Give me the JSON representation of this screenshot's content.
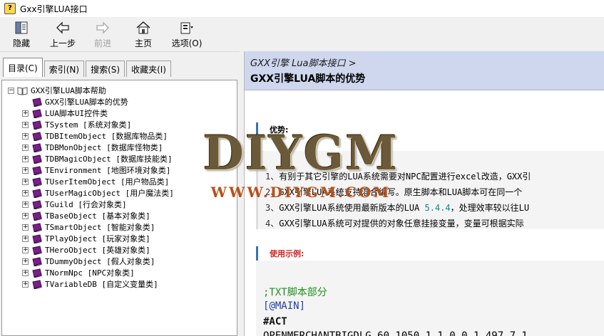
{
  "window": {
    "title": "Gxx引擎LUA接口"
  },
  "toolbar": {
    "hide": "隐藏",
    "back": "上一步",
    "forward": "前进",
    "home": "主页",
    "options": "选项(O)"
  },
  "tabs": [
    "目录(C)",
    "索引(N)",
    "搜索(S)",
    "收藏夹(I)"
  ],
  "tree": {
    "root": "GXX引擎LUA脚本帮助",
    "items": [
      "GXX引擎LUA脚本的优势",
      "LUA脚本UI控件类",
      "TSystem [系统对象类]",
      "TDBItemObject [数据库物品类]",
      "TDBMonObject [数据库怪物类]",
      "TDBMagicObject [数据库技能类]",
      "TEnvironment [地图环境对象类]",
      "TUserItemObject [用户物品类]",
      "TUserMagicObject [用户魔法类]",
      "TGuild [行会对象类]",
      "TBaseObject [基本对象类]",
      "TSmartObject [智能对象类]",
      "TPlayObject [玩家对象类]",
      "THeroObject [英雄对象类]",
      "TDummyObject [假人对象类]",
      "TNormNpc [NPC对象类]",
      "TVariableDB [自定义变量类]"
    ]
  },
  "content": {
    "breadcrumb": "GXX引擎 Lua脚本接口 >",
    "title": "GXX引擎LUA脚本的优势",
    "section1": "优势:",
    "list": [
      {
        "n": "1、",
        "text": "有别于其它引擎的LUA系统需要对NPC配置进行excel改造，GXX引"
      },
      {
        "n": "2、",
        "text": "GXX引擎LUA系统支持混合编写。原生脚本和LUA脚本可在同一个"
      },
      {
        "n": "3、",
        "text": "GXX引擎LUA系统使用最新版本的LUA ",
        "hl": "5.4.4",
        "rest": "，处理效率较以往LU"
      },
      {
        "n": "4、",
        "text": "GXX引擎LUA系统可对提供的对象任意挂接变量，变量可根据实际"
      }
    ],
    "section2": "使用示例:",
    "code": [
      ";TXT脚本部分",
      "[@MAIN]",
      "#ACT",
      "OPENMERCHANTBIGDLG 60 1050 1 1 0 0 1 497 7 1"
    ]
  },
  "watermark": {
    "logo": "DIYGM",
    "url": "WWW.DIYGM.COM"
  }
}
